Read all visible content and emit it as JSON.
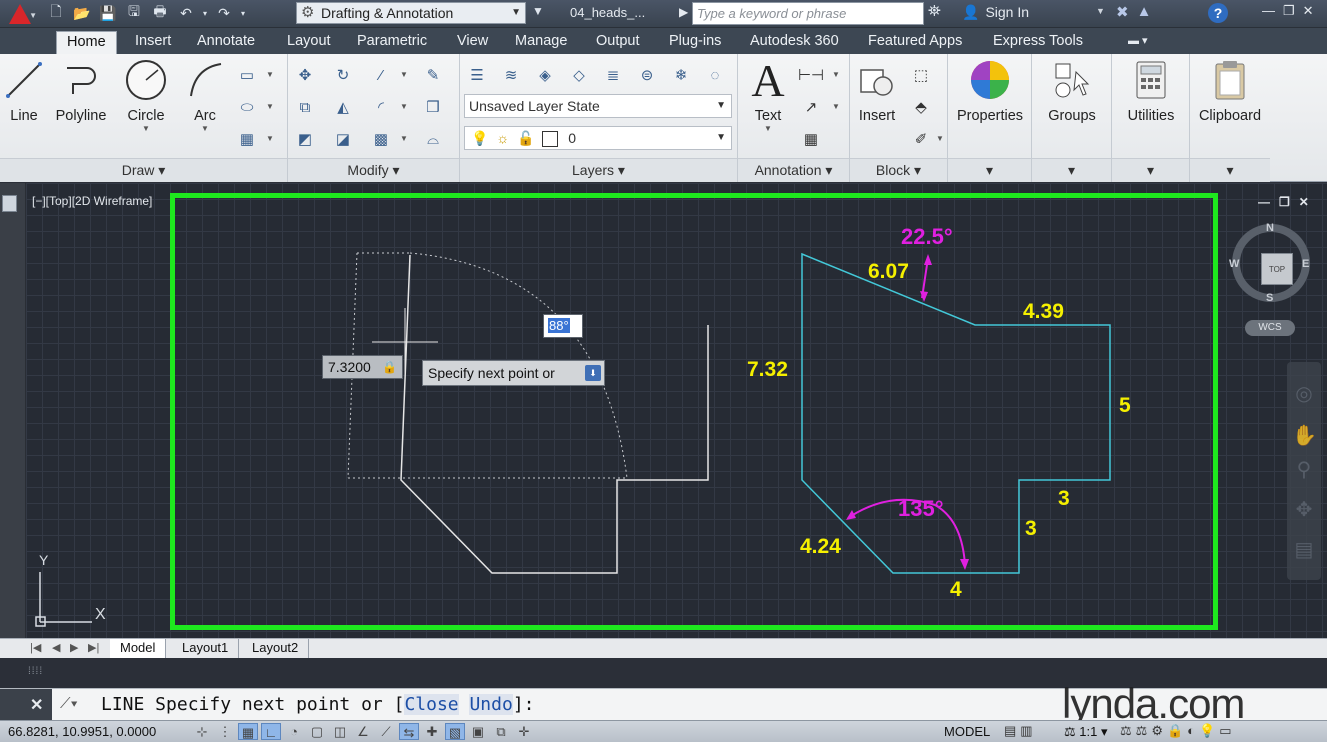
{
  "title_bar": {
    "workspace": "Drafting & Annotation",
    "document": "04_heads_...",
    "search_placeholder": "Type a keyword or phrase",
    "sign_in": "Sign In",
    "help": "?"
  },
  "ribbon_tabs": [
    "Home",
    "Insert",
    "Annotate",
    "Layout",
    "Parametric",
    "View",
    "Manage",
    "Output",
    "Plug-ins",
    "Autodesk 360",
    "Featured Apps",
    "Express Tools"
  ],
  "draw_panel": {
    "title": "Draw",
    "line": "Line",
    "polyline": "Polyline",
    "circle": "Circle",
    "arc": "Arc"
  },
  "modify_panel": {
    "title": "Modify"
  },
  "layers_panel": {
    "title": "Layers",
    "layer_state": "Unsaved Layer State",
    "current_layer": "0"
  },
  "annotation_panel": {
    "title": "Annotation",
    "text": "Text"
  },
  "block_panel": {
    "title": "Block",
    "insert": "Insert"
  },
  "properties": "Properties",
  "groups": "Groups",
  "utilities": "Utilities",
  "clipboard": "Clipboard",
  "viewport": {
    "label": "[−][Top][2D Wireframe]",
    "length_value": "7.3200",
    "angle_value": "88°",
    "prompt": "Specify next point or"
  },
  "viewcube": {
    "n": "N",
    "s": "S",
    "e": "E",
    "w": "W",
    "face": "TOP",
    "wcs": "WCS"
  },
  "ucs": {
    "x": "X",
    "y": "Y"
  },
  "dimensions": {
    "angle_top": "22.5°",
    "slant_top": "6.07",
    "top_right": "4.39",
    "left": "7.32",
    "right": "5",
    "step_h": "3",
    "step_v": "3",
    "bottom": "4",
    "chamfer": "4.24",
    "angle_bottom": "135°"
  },
  "layout_tabs": [
    "Model",
    "Layout1",
    "Layout2"
  ],
  "command": {
    "prefix": "LINE Specify next point or [",
    "opt1": "Close",
    "opt2": "Undo",
    "suffix": "]:"
  },
  "status": {
    "coords": "66.8281, 10.9951, 0.0000",
    "model": "MODEL",
    "scale": "1:1"
  },
  "watermark": "lynda.com",
  "colors": {
    "accent_green": "#1ee81e",
    "dim_yellow": "#f5f000",
    "angle_magenta": "#e020e0",
    "line_cyan": "#43c8d8",
    "line_white": "#e6e6e6"
  }
}
